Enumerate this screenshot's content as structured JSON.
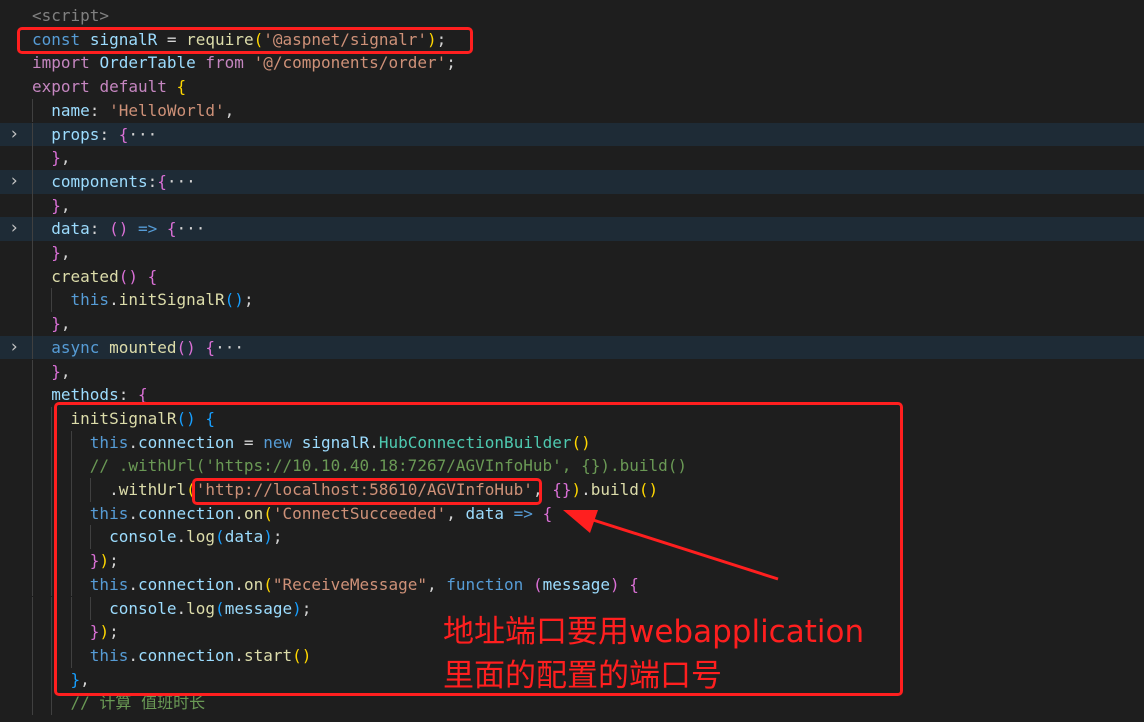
{
  "code_lines": [
    {
      "parts": [
        [
          "tag",
          "<script>"
        ]
      ]
    },
    {
      "parts": [
        [
          "kw",
          "const"
        ],
        [
          "p",
          " "
        ],
        [
          "var",
          "signalR"
        ],
        [
          "p",
          " = "
        ],
        [
          "fn",
          "require"
        ],
        [
          "b1",
          "("
        ],
        [
          "str",
          "'@aspnet/signalr'"
        ],
        [
          "b1",
          ")"
        ],
        [
          "p",
          ";"
        ]
      ]
    },
    {
      "parts": [
        [
          "kw2",
          "import"
        ],
        [
          "p",
          " "
        ],
        [
          "var",
          "OrderTable"
        ],
        [
          "p",
          " "
        ],
        [
          "kw2",
          "from"
        ],
        [
          "p",
          " "
        ],
        [
          "str",
          "'@/components/order'"
        ],
        [
          "p",
          ";"
        ]
      ]
    },
    {
      "parts": [
        [
          "kw2",
          "export"
        ],
        [
          "p",
          " "
        ],
        [
          "kw2",
          "default"
        ],
        [
          "p",
          " "
        ],
        [
          "b1",
          "{"
        ]
      ]
    },
    {
      "parts": [
        [
          "p",
          "  "
        ],
        [
          "var",
          "name"
        ],
        [
          "p",
          ": "
        ],
        [
          "str",
          "'HelloWorld'"
        ],
        [
          "p",
          ","
        ]
      ]
    },
    {
      "parts": [
        [
          "p",
          "  "
        ],
        [
          "var",
          "props"
        ],
        [
          "p",
          ": "
        ],
        [
          "b2",
          "{"
        ],
        [
          "dots",
          "···"
        ]
      ],
      "folded": true
    },
    {
      "parts": [
        [
          "p",
          "  "
        ],
        [
          "b2",
          "}"
        ],
        [
          "p",
          ","
        ]
      ]
    },
    {
      "parts": [
        [
          "p",
          "  "
        ],
        [
          "var",
          "components"
        ],
        [
          "p",
          ":"
        ],
        [
          "b2",
          "{"
        ],
        [
          "dots",
          "···"
        ]
      ],
      "folded": true
    },
    {
      "parts": [
        [
          "p",
          "  "
        ],
        [
          "b2",
          "}"
        ],
        [
          "p",
          ","
        ]
      ]
    },
    {
      "parts": [
        [
          "p",
          "  "
        ],
        [
          "var",
          "data"
        ],
        [
          "p",
          ": "
        ],
        [
          "b2",
          "()"
        ],
        [
          "p",
          " "
        ],
        [
          "kw",
          "=>"
        ],
        [
          "p",
          " "
        ],
        [
          "b2",
          "{"
        ],
        [
          "dots",
          "···"
        ]
      ],
      "folded": true
    },
    {
      "parts": [
        [
          "p",
          "  "
        ],
        [
          "b2",
          "}"
        ],
        [
          "p",
          ","
        ]
      ]
    },
    {
      "parts": [
        [
          "p",
          "  "
        ],
        [
          "fn",
          "created"
        ],
        [
          "b2",
          "()"
        ],
        [
          "p",
          " "
        ],
        [
          "b2",
          "{"
        ]
      ]
    },
    {
      "parts": [
        [
          "p",
          "    "
        ],
        [
          "kw",
          "this"
        ],
        [
          "p",
          "."
        ],
        [
          "fn",
          "initSignalR"
        ],
        [
          "b3",
          "()"
        ],
        [
          "p",
          ";"
        ]
      ]
    },
    {
      "parts": [
        [
          "p",
          "  "
        ],
        [
          "b2",
          "}"
        ],
        [
          "p",
          ","
        ]
      ]
    },
    {
      "parts": [
        [
          "p",
          "  "
        ],
        [
          "kw",
          "async"
        ],
        [
          "p",
          " "
        ],
        [
          "fn",
          "mounted"
        ],
        [
          "b2",
          "()"
        ],
        [
          "p",
          " "
        ],
        [
          "b2",
          "{"
        ],
        [
          "dots",
          "···"
        ]
      ],
      "folded": true
    },
    {
      "parts": [
        [
          "p",
          "  "
        ],
        [
          "b2",
          "}"
        ],
        [
          "p",
          ","
        ]
      ]
    },
    {
      "parts": [
        [
          "p",
          "  "
        ],
        [
          "var",
          "methods"
        ],
        [
          "p",
          ": "
        ],
        [
          "b2",
          "{"
        ]
      ]
    },
    {
      "parts": [
        [
          "p",
          "    "
        ],
        [
          "fn",
          "initSignalR"
        ],
        [
          "b3",
          "()"
        ],
        [
          "p",
          " "
        ],
        [
          "b3",
          "{"
        ]
      ]
    },
    {
      "parts": [
        [
          "p",
          "      "
        ],
        [
          "kw",
          "this"
        ],
        [
          "p",
          "."
        ],
        [
          "var",
          "connection"
        ],
        [
          "p",
          " = "
        ],
        [
          "kw",
          "new"
        ],
        [
          "p",
          " "
        ],
        [
          "var",
          "signalR"
        ],
        [
          "p",
          "."
        ],
        [
          "cls",
          "HubConnectionBuilder"
        ],
        [
          "b1",
          "()"
        ]
      ]
    },
    {
      "parts": [
        [
          "p",
          "      "
        ],
        [
          "cmt",
          "// .withUrl('https://10.10.40.18:7267/AGVInfoHub', {}).build()"
        ]
      ]
    },
    {
      "parts": [
        [
          "p",
          "        ."
        ],
        [
          "fn",
          "withUrl"
        ],
        [
          "b1",
          "("
        ],
        [
          "str",
          "'http://localhost:58610/AGVInfoHub'"
        ],
        [
          "p",
          ", "
        ],
        [
          "b2",
          "{}"
        ],
        [
          "b1",
          ")"
        ],
        [
          "p",
          "."
        ],
        [
          "fn",
          "build"
        ],
        [
          "b1",
          "()"
        ]
      ]
    },
    {
      "parts": [
        [
          "p",
          "      "
        ],
        [
          "kw",
          "this"
        ],
        [
          "p",
          "."
        ],
        [
          "var",
          "connection"
        ],
        [
          "p",
          "."
        ],
        [
          "fn",
          "on"
        ],
        [
          "b1",
          "("
        ],
        [
          "str",
          "'ConnectSucceeded'"
        ],
        [
          "p",
          ", "
        ],
        [
          "var",
          "data"
        ],
        [
          "p",
          " "
        ],
        [
          "kw",
          "=>"
        ],
        [
          "p",
          " "
        ],
        [
          "b2",
          "{"
        ]
      ]
    },
    {
      "parts": [
        [
          "p",
          "        "
        ],
        [
          "var",
          "console"
        ],
        [
          "p",
          "."
        ],
        [
          "fn",
          "log"
        ],
        [
          "b3",
          "("
        ],
        [
          "var",
          "data"
        ],
        [
          "b3",
          ")"
        ],
        [
          "p",
          ";"
        ]
      ]
    },
    {
      "parts": [
        [
          "p",
          "      "
        ],
        [
          "b2",
          "}"
        ],
        [
          "b1",
          ")"
        ],
        [
          "p",
          ";"
        ]
      ]
    },
    {
      "parts": [
        [
          "p",
          "      "
        ],
        [
          "kw",
          "this"
        ],
        [
          "p",
          "."
        ],
        [
          "var",
          "connection"
        ],
        [
          "p",
          "."
        ],
        [
          "fn",
          "on"
        ],
        [
          "b1",
          "("
        ],
        [
          "str",
          "\"ReceiveMessage\""
        ],
        [
          "p",
          ", "
        ],
        [
          "kw",
          "function"
        ],
        [
          "p",
          " "
        ],
        [
          "b2",
          "("
        ],
        [
          "var",
          "message"
        ],
        [
          "b2",
          ")"
        ],
        [
          "p",
          " "
        ],
        [
          "b2",
          "{"
        ]
      ]
    },
    {
      "parts": [
        [
          "p",
          "        "
        ],
        [
          "var",
          "console"
        ],
        [
          "p",
          "."
        ],
        [
          "fn",
          "log"
        ],
        [
          "b3",
          "("
        ],
        [
          "var",
          "message"
        ],
        [
          "b3",
          ")"
        ],
        [
          "p",
          ";"
        ]
      ]
    },
    {
      "parts": [
        [
          "p",
          "      "
        ],
        [
          "b2",
          "}"
        ],
        [
          "b1",
          ")"
        ],
        [
          "p",
          ";"
        ]
      ]
    },
    {
      "parts": [
        [
          "p",
          "      "
        ],
        [
          "kw",
          "this"
        ],
        [
          "p",
          "."
        ],
        [
          "var",
          "connection"
        ],
        [
          "p",
          "."
        ],
        [
          "fn",
          "start"
        ],
        [
          "b1",
          "()"
        ]
      ]
    },
    {
      "parts": [
        [
          "p",
          "    "
        ],
        [
          "b3",
          "}"
        ],
        [
          "p",
          ","
        ]
      ]
    },
    {
      "parts": [
        [
          "p",
          "    "
        ],
        [
          "cmt",
          "// 计算 值班时长"
        ]
      ]
    }
  ],
  "annotation": {
    "line1": "地址端口要用webapplication",
    "line2": "里面的配置的端口号"
  },
  "colors": {
    "background": "#1e1e1e",
    "highlight": "#ff1f1f"
  }
}
